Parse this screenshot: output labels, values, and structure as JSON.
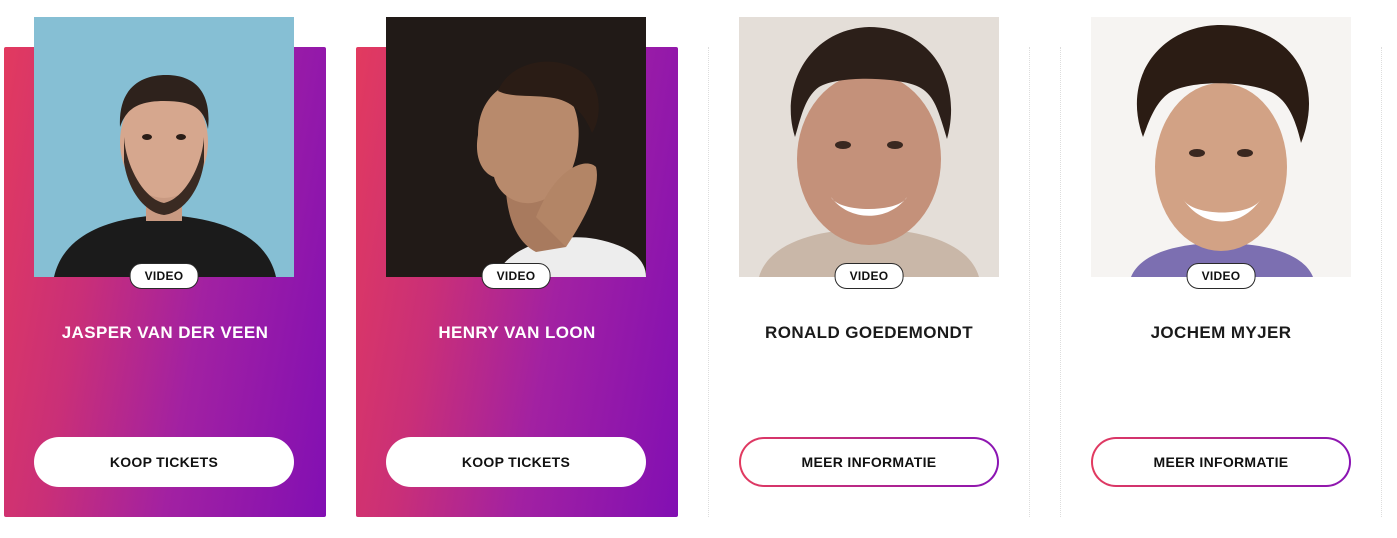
{
  "cards": [
    {
      "name": "JASPER VAN DER VEEN",
      "video_label": "VIDEO",
      "cta_label": "KOOP TICKETS",
      "style": "gradient",
      "photo": "portrait of man with beard on light blue background"
    },
    {
      "name": "HENRY VAN LOON",
      "video_label": "VIDEO",
      "cta_label": "KOOP TICKETS",
      "style": "gradient",
      "photo": "profile portrait of man on dark background"
    },
    {
      "name": "RONALD GOEDEMONDT",
      "video_label": "VIDEO",
      "cta_label": "MEER INFORMATIE",
      "style": "plain",
      "photo": "smiling man with curly hair"
    },
    {
      "name": "JOCHEM MYJER",
      "video_label": "VIDEO",
      "cta_label": "MEER INFORMATIE",
      "style": "plain",
      "photo": "smiling man with curly hair on white background"
    }
  ],
  "colors": {
    "gradient_start": "#e23a5f",
    "gradient_end": "#820fb3",
    "text_dark": "#111111",
    "text_light": "#ffffff"
  }
}
